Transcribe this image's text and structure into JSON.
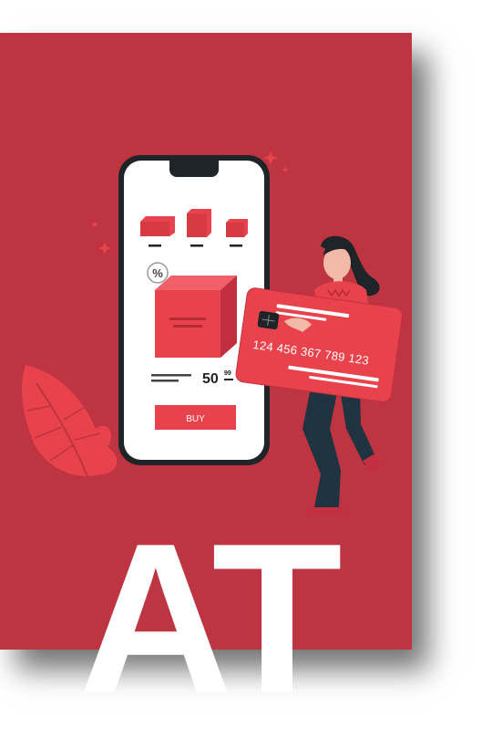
{
  "phone": {
    "price_main": "50",
    "price_cents": "99",
    "buy_label": "BUY",
    "discount_symbol": "%"
  },
  "card": {
    "number": "124 456 367 789 123"
  },
  "headline": {
    "text": "AT"
  },
  "colors": {
    "background": "#be3440",
    "accent": "#e8434d",
    "phone_frame": "#1f2428",
    "screen": "#ffffff",
    "text_dark": "#222222"
  },
  "icons": [
    "percent-icon",
    "leaf-icon",
    "sparkle-icon",
    "box-icon"
  ]
}
